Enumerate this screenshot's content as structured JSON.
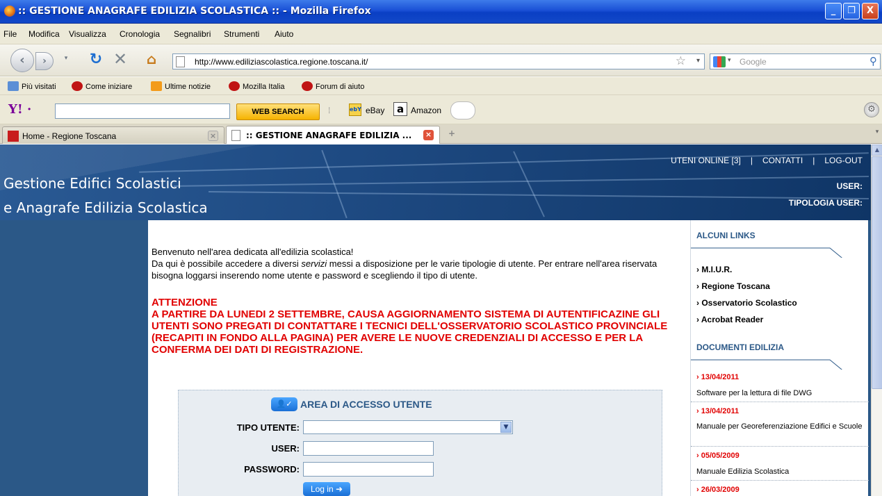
{
  "window": {
    "title": ":: GESTIONE ANAGRAFE EDILIZIA SCOLASTICA :: - Mozilla Firefox",
    "min": "_",
    "max": "❐",
    "close": "X"
  },
  "menu": [
    "File",
    "Modifica",
    "Visualizza",
    "Cronologia",
    "Segnalibri",
    "Strumenti",
    "Aiuto"
  ],
  "nav": {
    "url": "http://www.ediliziascolastica.regione.toscana.it/",
    "search_placeholder": "Google"
  },
  "bookmarks": [
    "Più visitati",
    "Come iniziare",
    "Ultime notizie",
    "Mozilla Italia",
    "Forum di aiuto"
  ],
  "yahoo": {
    "web_search": "WEB SEARCH",
    "ebay": "eBay",
    "amazon": "Amazon",
    "amazon_icon": "a",
    "ebay_icon": "ebY"
  },
  "tabs": [
    {
      "label": "Home - Regione Toscana",
      "active": false
    },
    {
      "label": ":: GESTIONE ANAGRAFE EDILIZIA ...",
      "active": true
    }
  ],
  "banner": {
    "title_line1": "Gestione Edifici Scolastici",
    "title_line2": "e Anagrafe Edilizia Scolastica",
    "links": {
      "online": "UTENI ONLINE [3]",
      "sep": "|",
      "contact": "CONTATTI",
      "logout": "LOG-OUT"
    },
    "user_label": "USER:",
    "user_type_label": "TIPOLOGIA USER:"
  },
  "main": {
    "welcome": "Benvenuto nell'area dedicata all'edilizia scolastica!",
    "intro_pre": "Da qui è possibile accedere a diversi ",
    "intro_em": "servizi",
    "intro_post": " messi a disposizione per le varie tipologie di utente. Per entrare nell'area riservata bisogna loggarsi inserendo nome utente e password e scegliendo il tipo di utente.",
    "warn_title": "ATTENZIONE",
    "warn_body": "A PARTIRE DA LUNEDI 2 SETTEMBRE, CAUSA AGGIORNAMENTO SISTEMA DI AUTENTIFICAZINE GLI UTENTI SONO PREGATI DI CONTATTARE I TECNICI DELL'OSSERVATORIO SCOLASTICO PROVINCIALE (RECAPITI IN FONDO ALLA PAGINA) PER AVERE LE NUOVE CREDENZIALI DI ACCESSO E PER LA CONFERMA DEI DATI DI REGISTRAZIONE."
  },
  "login": {
    "heading": "AREA DI ACCESSO UTENTE",
    "type_label": "TIPO UTENTE:",
    "type_value": "",
    "user_label": "USER:",
    "user_value": "",
    "password_label": "PASSWORD:",
    "password_value": "",
    "button": "Log in ➜"
  },
  "sidebar": {
    "links_heading": "ALCUNI LINKS",
    "links": [
      "› M.I.U.R.",
      "› Regione Toscana",
      "› Osservatorio Scolastico",
      "› Acrobat Reader"
    ],
    "docs_heading": "DOCUMENTI EDILIZIA",
    "docs": [
      {
        "date": "› 13/04/2011",
        "desc": "Software per la lettura di file DWG"
      },
      {
        "date": "› 13/04/2011",
        "desc": "Manuale per Georeferenziazione Edifici e Scuole"
      },
      {
        "date": "› 05/05/2009",
        "desc": "Manuale Edilizia Scolastica"
      },
      {
        "date": "› 26/03/2009",
        "desc": ""
      }
    ]
  }
}
